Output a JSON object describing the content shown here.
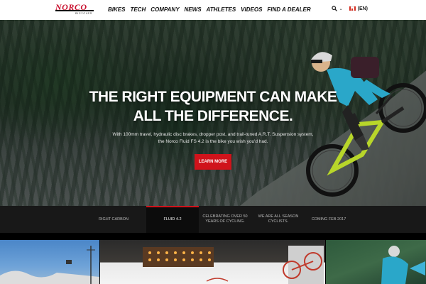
{
  "brand": {
    "name": "NORCO",
    "subtitle": "BICYCLES",
    "color": "#c8102e"
  },
  "nav": {
    "items": [
      "BIKES",
      "TECH",
      "COMPANY",
      "NEWS",
      "ATHLETES",
      "VIDEOS",
      "FIND A DEALER"
    ]
  },
  "tools": {
    "search_icon": "search-icon",
    "language": "(EN)"
  },
  "hero": {
    "headline_line1": "THE RIGHT EQUIPMENT CAN MAKE",
    "headline_line2": "ALL THE DIFFERENCE.",
    "subtext_line1": "With 100mm travel, hydraulic disc brakes, dropper post, and trail-tuned A.R.T. Suspension system,",
    "subtext_line2": "the Norco Fluid FS 4.2 is the bike you wish you'd had.",
    "cta_label": "LEARN MORE",
    "cta_color": "#d0131b"
  },
  "slides": {
    "tabs": [
      {
        "label": "RIGHT CARBON",
        "active": false
      },
      {
        "label": "FLUID 4.2",
        "active": true
      },
      {
        "label": "CELEBRATING OVER 50 YEARS OF CYCLING.",
        "active": false
      },
      {
        "label": "WE ARE ALL SEASON CYCLISTS.",
        "active": false
      },
      {
        "label": "COMING FEB 2017",
        "active": false
      }
    ]
  }
}
